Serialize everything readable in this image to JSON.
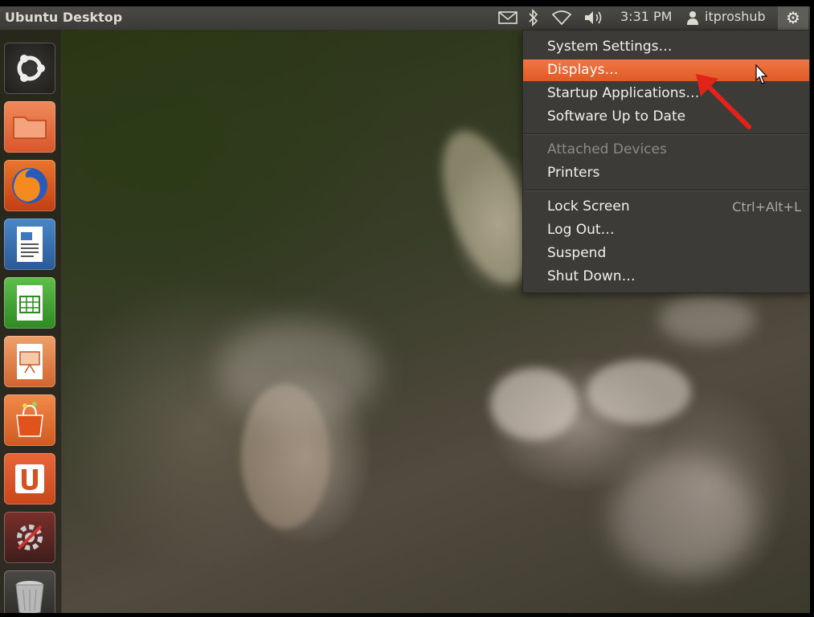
{
  "panel": {
    "title": "Ubuntu Desktop",
    "time": "3:31 PM",
    "user": "itproshub",
    "icons": [
      "mail-icon",
      "bluetooth-icon",
      "wifi-icon",
      "volume-icon",
      "user-icon",
      "gear-icon"
    ]
  },
  "launcher": {
    "items": [
      {
        "name": "dash-home",
        "icon": "ubuntu-logo-icon"
      },
      {
        "name": "home-folder",
        "icon": "folder-icon"
      },
      {
        "name": "firefox",
        "icon": "firefox-icon"
      },
      {
        "name": "libreoffice-writer",
        "icon": "writer-icon"
      },
      {
        "name": "libreoffice-calc",
        "icon": "calc-icon"
      },
      {
        "name": "libreoffice-impress",
        "icon": "impress-icon"
      },
      {
        "name": "software-center",
        "icon": "shopping-bag-icon"
      },
      {
        "name": "ubuntu-one",
        "icon": "ubuntu-one-icon"
      },
      {
        "name": "system-settings",
        "icon": "settings-icon"
      },
      {
        "name": "trash",
        "icon": "trash-icon"
      }
    ]
  },
  "menu": {
    "system_settings": "System Settings…",
    "displays": "Displays…",
    "startup_applications": "Startup Applications…",
    "software_up_to_date": "Software Up to Date",
    "attached_devices": "Attached Devices",
    "printers": "Printers",
    "lock_screen": "Lock Screen",
    "lock_screen_shortcut": "Ctrl+Alt+L",
    "log_out": "Log Out…",
    "suspend": "Suspend",
    "shut_down": "Shut Down…"
  },
  "colors": {
    "accent": "#e9652d",
    "panel_bg": "#3c3b37",
    "arrow": "#e2231a"
  }
}
